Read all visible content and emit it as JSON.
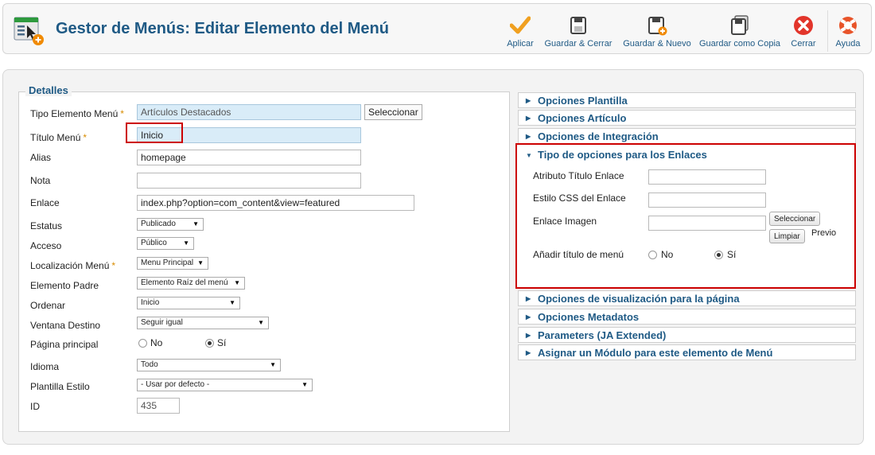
{
  "header": {
    "title": "Gestor de Menús: Editar Elemento del Menú"
  },
  "toolbar": {
    "apply": "Aplicar",
    "save_close": "Guardar & Cerrar",
    "save_new": "Guardar & Nuevo",
    "save_copy": "Guardar como Copia",
    "close": "Cerrar",
    "help": "Ayuda"
  },
  "details": {
    "legend": "Detalles",
    "menu_item_type": {
      "label": "Tipo Elemento Menú",
      "value": "Artículos Destacados",
      "button": "Seleccionar"
    },
    "menu_title": {
      "label": "Título Menú",
      "value": "Inicio"
    },
    "alias": {
      "label": "Alias",
      "value": "homepage"
    },
    "note": {
      "label": "Nota",
      "value": ""
    },
    "link": {
      "label": "Enlace",
      "value": "index.php?option=com_content&view=featured"
    },
    "status": {
      "label": "Estatus",
      "value": "Publicado"
    },
    "access": {
      "label": "Acceso",
      "value": "Público"
    },
    "menu_location": {
      "label": "Localización Menú",
      "value": "Menu Principal"
    },
    "parent_item": {
      "label": "Elemento Padre",
      "value": "Elemento Raíz del menú"
    },
    "ordering": {
      "label": "Ordenar",
      "value": "Inicio"
    },
    "target_window": {
      "label": "Ventana Destino",
      "value": "Seguir igual"
    },
    "default_page": {
      "label": "Página principal",
      "no": "No",
      "yes": "Sí",
      "selected": "yes"
    },
    "language": {
      "label": "Idioma",
      "value": "Todo"
    },
    "template_style": {
      "label": "Plantilla Estilo",
      "value": "- Usar por defecto -"
    },
    "id": {
      "label": "ID",
      "value": "435"
    }
  },
  "accordion": {
    "template_options": "Opciones Plantilla",
    "article_options": "Opciones Artículo",
    "integration_options": "Opciones de Integración",
    "link_type_options": "Tipo de opciones para los Enlaces",
    "page_display_options": "Opciones de visualización para la página",
    "metadata_options": "Opciones Metadatos",
    "parameters": "Parameters (JA Extended)",
    "module_assignment": "Asignar un Módulo para este elemento de Menú"
  },
  "link_options": {
    "link_title_attr": "Atributo Título Enlace",
    "link_css_style": "Estilo CSS del Enlace",
    "link_image": "Enlace Imagen",
    "select_button": "Seleccionar",
    "clear_button": "Limpiar",
    "preview": "Previo",
    "add_menu_title": "Añadir título de menú",
    "no": "No",
    "yes": "Sí",
    "selected": "yes"
  },
  "colors": {
    "accent": "#1f5a85",
    "highlight": "#cc0000",
    "required": "#d88c00"
  }
}
